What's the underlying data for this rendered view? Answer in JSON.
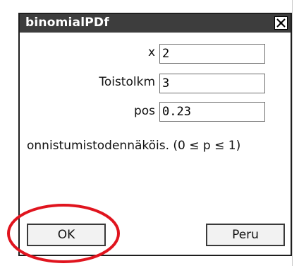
{
  "dialog": {
    "title": "binomialPDf",
    "close_symbol": "✕"
  },
  "fields": [
    {
      "label": "x",
      "value": "2"
    },
    {
      "label": "Toistolkm",
      "value": "3"
    },
    {
      "label": "pos",
      "value": "0.23"
    }
  ],
  "hint": "onnistumistodennäköis. (0 ≤ p ≤ 1)",
  "buttons": {
    "ok_label": "OK",
    "cancel_label": "Peru"
  },
  "colors": {
    "titlebar": "#3d3d3d",
    "highlight": "#e0141e"
  }
}
